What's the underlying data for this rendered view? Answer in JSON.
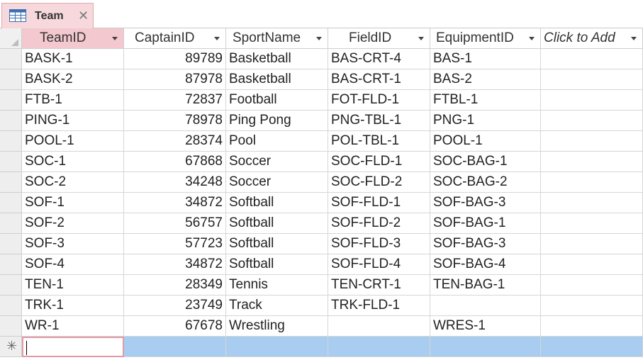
{
  "tab": {
    "title": "Team",
    "icon": "table-icon",
    "close_icon": "close-icon",
    "close_glyph": "✕"
  },
  "columns": [
    {
      "key": "TeamID",
      "label": "TeamID"
    },
    {
      "key": "CaptainID",
      "label": "CaptainID"
    },
    {
      "key": "SportName",
      "label": "SportName"
    },
    {
      "key": "FieldID",
      "label": "FieldID"
    },
    {
      "key": "EquipmentID",
      "label": "EquipmentID"
    },
    {
      "key": "ClickToAdd",
      "label": "Click to Add"
    }
  ],
  "rows": [
    [
      "BASK-1",
      "89789",
      "Basketball",
      "BAS-CRT-4",
      "BAS-1",
      ""
    ],
    [
      "BASK-2",
      "87978",
      "Basketball",
      "BAS-CRT-1",
      "BAS-2",
      ""
    ],
    [
      "FTB-1",
      "72837",
      "Football",
      "FOT-FLD-1",
      "FTBL-1",
      ""
    ],
    [
      "PING-1",
      "78978",
      "Ping Pong",
      "PNG-TBL-1",
      "PNG-1",
      ""
    ],
    [
      "POOL-1",
      "28374",
      "Pool",
      "POL-TBL-1",
      "POOL-1",
      ""
    ],
    [
      "SOC-1",
      "67868",
      "Soccer",
      "SOC-FLD-1",
      "SOC-BAG-1",
      ""
    ],
    [
      "SOC-2",
      "34248",
      "Soccer",
      "SOC-FLD-2",
      "SOC-BAG-2",
      ""
    ],
    [
      "SOF-1",
      "34872",
      "Softball",
      "SOF-FLD-1",
      "SOF-BAG-3",
      ""
    ],
    [
      "SOF-2",
      "56757",
      "Softball",
      "SOF-FLD-2",
      "SOF-BAG-1",
      ""
    ],
    [
      "SOF-3",
      "57723",
      "Softball",
      "SOF-FLD-3",
      "SOF-BAG-3",
      ""
    ],
    [
      "SOF-4",
      "34872",
      "Softball",
      "SOF-FLD-4",
      "SOF-BAG-4",
      ""
    ],
    [
      "TEN-1",
      "28349",
      "Tennis",
      "TEN-CRT-1",
      "TEN-BAG-1",
      ""
    ],
    [
      "TRK-1",
      "23749",
      "Track",
      "TRK-FLD-1",
      "",
      ""
    ],
    [
      "WR-1",
      "67678",
      "Wrestling",
      "",
      "WRES-1",
      ""
    ]
  ],
  "new_row": {
    "marker": "✳",
    "marker_icon": "new-record-icon"
  },
  "colors": {
    "tab_bg": "#f7d8dc",
    "active_header": "#f3c8ce",
    "new_row": "#a8cdf0",
    "active_border": "#e39aa6"
  }
}
